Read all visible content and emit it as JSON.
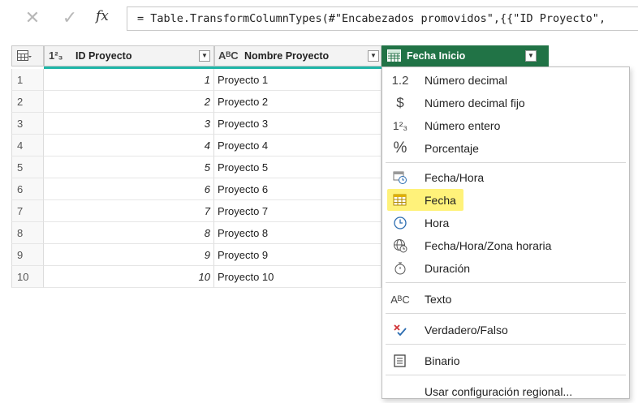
{
  "formula_bar": {
    "cancel_glyph": "✕",
    "confirm_glyph": "✓",
    "fx_label": "fx",
    "formula": "= Table.TransformColumnTypes(#\"Encabezados promovidos\",{{\"ID Proyecto\","
  },
  "grid": {
    "columns": [
      {
        "type_icon": "1²₃",
        "label": "ID Proyecto",
        "dropdown": "▼"
      },
      {
        "type_icon": "AᴮC",
        "label": "Nombre Proyecto",
        "dropdown": "▼"
      },
      {
        "type_icon": "calendar-icon",
        "label": "Fecha Inicio",
        "dropdown": "▼",
        "selected": true
      }
    ],
    "rows": [
      {
        "n": "1",
        "id": "1",
        "name": "Proyecto 1"
      },
      {
        "n": "2",
        "id": "2",
        "name": "Proyecto 2"
      },
      {
        "n": "3",
        "id": "3",
        "name": "Proyecto 3"
      },
      {
        "n": "4",
        "id": "4",
        "name": "Proyecto 4"
      },
      {
        "n": "5",
        "id": "5",
        "name": "Proyecto 5"
      },
      {
        "n": "6",
        "id": "6",
        "name": "Proyecto 6"
      },
      {
        "n": "7",
        "id": "7",
        "name": "Proyecto 7"
      },
      {
        "n": "8",
        "id": "8",
        "name": "Proyecto 8"
      },
      {
        "n": "9",
        "id": "9",
        "name": "Proyecto 9"
      },
      {
        "n": "10",
        "id": "10",
        "name": "Proyecto 10"
      }
    ]
  },
  "type_menu": {
    "items": [
      {
        "icon_text": "1.2",
        "label": "Número decimal"
      },
      {
        "icon_text": "$",
        "label": "Número decimal fijo"
      },
      {
        "icon_text": "1²₃",
        "label": "Número entero"
      },
      {
        "icon_text": "%",
        "label": "Porcentaje"
      },
      {
        "icon": "datetime-icon",
        "label": "Fecha/Hora"
      },
      {
        "icon": "calendar-icon",
        "label": "Fecha",
        "highlighted": true
      },
      {
        "icon": "clock-icon",
        "label": "Hora"
      },
      {
        "icon": "globe-clock-icon",
        "label": "Fecha/Hora/Zona horaria"
      },
      {
        "icon": "stopwatch-icon",
        "label": "Duración"
      },
      {
        "icon_text": "AᴮC",
        "label": "Texto"
      },
      {
        "icon": "check-x-icon",
        "label": "Verdadero/Falso"
      },
      {
        "icon": "binary-icon",
        "label": "Binario"
      },
      {
        "label": "Usar configuración regional..."
      }
    ]
  },
  "colors": {
    "selected_header": "#217346",
    "highlight": "#fff27a",
    "quality_bar": "#1fb6a8"
  }
}
